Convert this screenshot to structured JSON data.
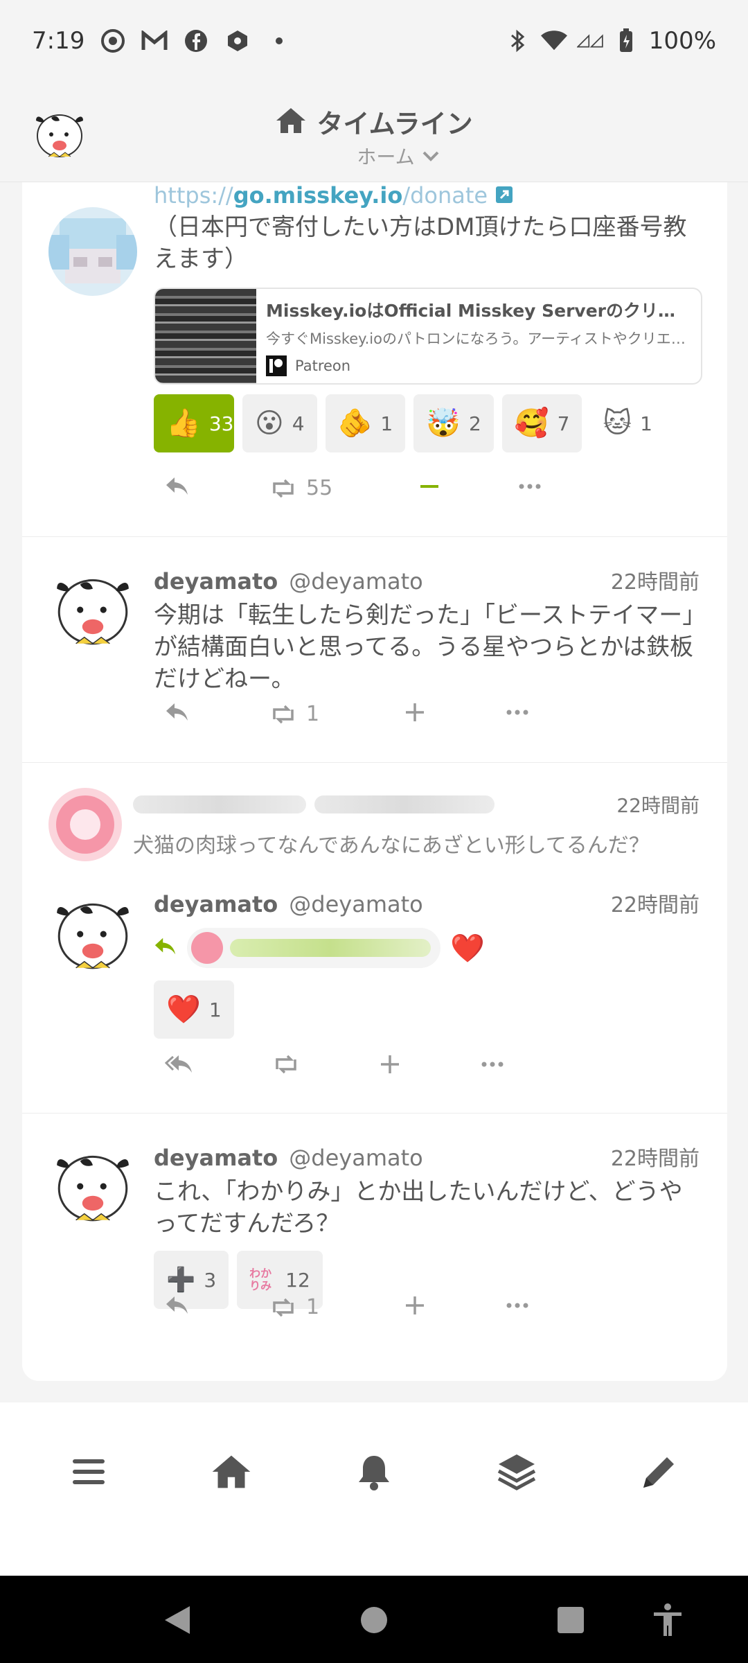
{
  "status_bar": {
    "time": "7:19",
    "battery": "100%",
    "left_icons": [
      "chrome-icon",
      "gmail-icon",
      "facebook-icon",
      "app-icon",
      "dot-icon"
    ],
    "right_icons": [
      "bluetooth-icon",
      "wifi-icon",
      "signal-icon",
      "battery-icon"
    ]
  },
  "header": {
    "title": "タイムライン",
    "subtitle": "ホーム"
  },
  "notes": [
    {
      "link_prefix": "https://",
      "link_host": "go.misskey.io",
      "link_path": "/donate",
      "text": "（日本円で寄付したい方はDM頂けたら口座番号教えます）",
      "preview": {
        "title": "Misskey.ioはOfficial Misskey Serverのクリエイター",
        "description": "今すぐMisskey.ioのパトロンになろう。アーティストやクリエイ...",
        "site": "Patreon"
      },
      "reactions": [
        {
          "emoji": "👍",
          "count": "33",
          "active": true
        },
        {
          "emoji": "😮",
          "count": "4"
        },
        {
          "emoji": "🫵",
          "count": "1"
        },
        {
          "emoji": "🤯",
          "count": "2"
        },
        {
          "emoji": "🥰",
          "count": "7"
        },
        {
          "emoji": "🐱",
          "count": "1"
        }
      ],
      "renote_count": "55"
    },
    {
      "name": "deyamato",
      "username": "@deyamato",
      "time": "22時間前",
      "text": "今期は「転生したら剣だった」「ビーストテイマー」が結構面白いと思ってる。うる星やつらとかは鉄板だけどねー。",
      "renote_count": "1"
    },
    {
      "reply_time": "22時間前",
      "reply_text": "犬猫の肉球ってなんであんなにあざとい形してるんだ？",
      "name": "deyamato",
      "username": "@deyamato",
      "time": "22時間前",
      "reaction_emoji": "❤️",
      "reactions": [
        {
          "emoji": "❤️",
          "count": "1"
        }
      ]
    },
    {
      "name": "deyamato",
      "username": "@deyamato",
      "time": "22時間前",
      "text": "これ、「わかりみ」とか出したいんだけど、どうやってだすんだろ？",
      "reactions": [
        {
          "emoji": "➕",
          "count": "3"
        },
        {
          "emoji": "わかりみ",
          "count": "12"
        }
      ],
      "renote_count": "1"
    }
  ],
  "colors": {
    "accent": "#86b300",
    "link": "#44a4c1",
    "heart": "#dd2e44"
  }
}
